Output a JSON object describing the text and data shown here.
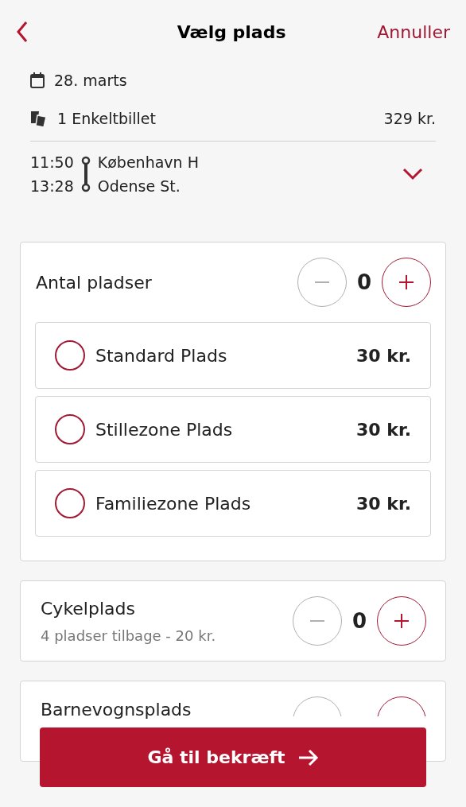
{
  "header": {
    "title": "Vælg plads",
    "cancel": "Annuller"
  },
  "summary": {
    "date": "28. marts",
    "ticket": "1 Enkeltbillet",
    "price": "329 kr."
  },
  "journey": {
    "expanded": false,
    "stops": [
      {
        "time": "11:50",
        "station": "København H"
      },
      {
        "time": "13:28",
        "station": "Odense St."
      }
    ]
  },
  "seats": {
    "label": "Antal pladser",
    "count": "0",
    "options": [
      {
        "name": "Standard Plads",
        "price": "30 kr.",
        "selected": false
      },
      {
        "name": "Stillezone Plads",
        "price": "30 kr.",
        "selected": false
      },
      {
        "name": "Familiezone Plads",
        "price": "30 kr.",
        "selected": false
      }
    ]
  },
  "extras": [
    {
      "name": "Cykelplads",
      "detail": "4 pladser tilbage - 20 kr.",
      "count": "0"
    },
    {
      "name": "Barnevognsplads"
    }
  ],
  "confirm_button": "Gå til bekræft"
}
